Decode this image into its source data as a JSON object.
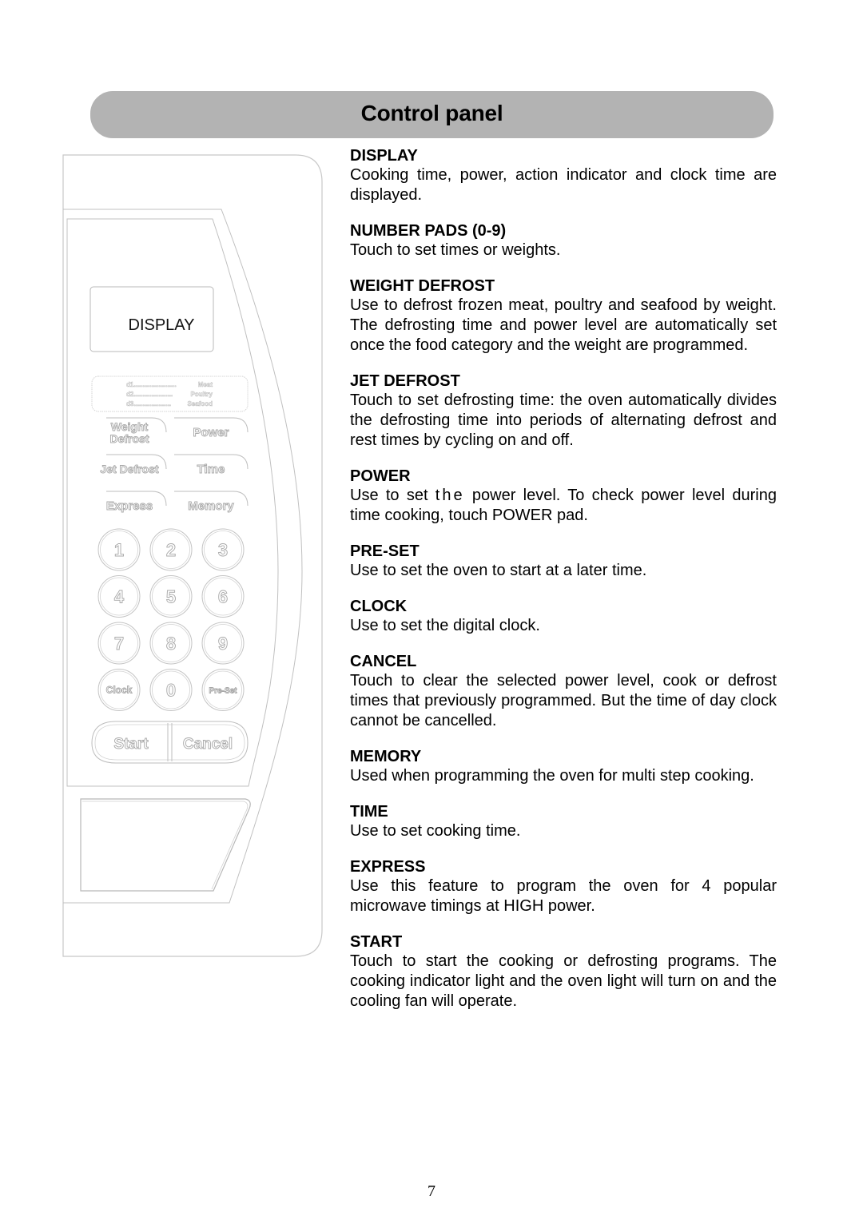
{
  "header": {
    "title": "Control panel"
  },
  "panel": {
    "display_label": "DISPLAY",
    "defrost_legend": [
      {
        "code": "d1",
        "dots": "........................",
        "category": "Meat"
      },
      {
        "code": "d2",
        "dots": "......................",
        "category": "Poultry"
      },
      {
        "code": "d3",
        "dots": ".....................",
        "category": "Seafood"
      }
    ],
    "function_keys": [
      {
        "id": "weight-defrost",
        "line1": "Weight",
        "line2": "Defrost"
      },
      {
        "id": "power",
        "line1": "Power"
      },
      {
        "id": "jet-defrost",
        "line1": "Jet Defrost"
      },
      {
        "id": "time",
        "line1": "Time"
      },
      {
        "id": "express",
        "line1": "Express"
      },
      {
        "id": "memory",
        "line1": "Memory"
      }
    ],
    "number_keys": [
      "1",
      "2",
      "3",
      "4",
      "5",
      "6",
      "7",
      "8",
      "9",
      "Clock",
      "0",
      "Pre-Set"
    ],
    "start_label": "Start",
    "cancel_label": "Cancel"
  },
  "sections": [
    {
      "title": "DISPLAY",
      "body": "Cooking time, power, action indicator and clock time are displayed."
    },
    {
      "title": "NUMBER PADS (0-9)",
      "body": "Touch to set times or weights."
    },
    {
      "title": "WEIGHT DEFROST",
      "body": "Use to defrost frozen meat, poultry and seafood by weight.  The defrosting time and power level are automatically set once the food category and the weight are programmed."
    },
    {
      "title": "JET DEFROST",
      "body": "Touch to set defrosting time: the oven automatically divides the defrosting time into periods of alternating defrost and rest times by cycling on and off."
    },
    {
      "title": "POWER",
      "body_pre": "Use to set ",
      "body_spaced": "the",
      "body_post": " power level. To check power level during time cooking, touch POWER pad."
    },
    {
      "title": "PRE-SET",
      "body": "Use to set the oven to start at a later time."
    },
    {
      "title": "CLOCK",
      "body": "Use to set the digital clock."
    },
    {
      "title": "CANCEL",
      "body": "Touch to clear the selected power level, cook or defrost times that previously programmed. But the time of day clock cannot be cancelled."
    },
    {
      "title": "MEMORY",
      "body": "Used when programming the oven for multi step cooking."
    },
    {
      "title": "TIME",
      "body": "Use to set cooking time."
    },
    {
      "title": "EXPRESS",
      "body": "Use this feature to program the oven for 4 popular microwave timings at HIGH power."
    },
    {
      "title": "START",
      "body": "Touch to start the cooking or defrosting programs. The cooking indicator light and the oven light will turn on and the cooling fan will operate."
    }
  ],
  "page_number": "7"
}
